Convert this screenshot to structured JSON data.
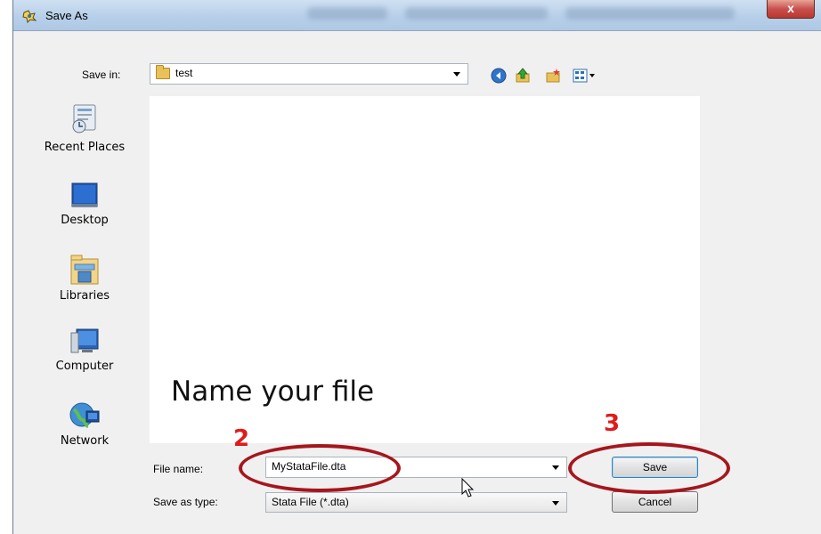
{
  "window": {
    "title": "Save As",
    "close_label": "x"
  },
  "toolbar": {
    "save_in_label": "Save in:",
    "save_in_value": "test",
    "icons": [
      "back-icon",
      "up-folder-icon",
      "new-folder-icon",
      "views-menu-icon"
    ]
  },
  "places": [
    {
      "label": "Recent Places",
      "icon": "recent-places-icon"
    },
    {
      "label": "Desktop",
      "icon": "desktop-icon"
    },
    {
      "label": "Libraries",
      "icon": "libraries-icon"
    },
    {
      "label": "Computer",
      "icon": "computer-icon"
    },
    {
      "label": "Network",
      "icon": "network-icon"
    }
  ],
  "annotations": {
    "instruction": "Name your file",
    "step2": "2",
    "step3": "3",
    "ring_color": "#a5161d",
    "number_color": "#e01b1b"
  },
  "form": {
    "file_name_label": "File name:",
    "file_name_value": "MyStataFile.dta",
    "save_type_label": "Save as type:",
    "save_type_value": "Stata File (*.dta)"
  },
  "buttons": {
    "save": "Save",
    "cancel": "Cancel"
  }
}
